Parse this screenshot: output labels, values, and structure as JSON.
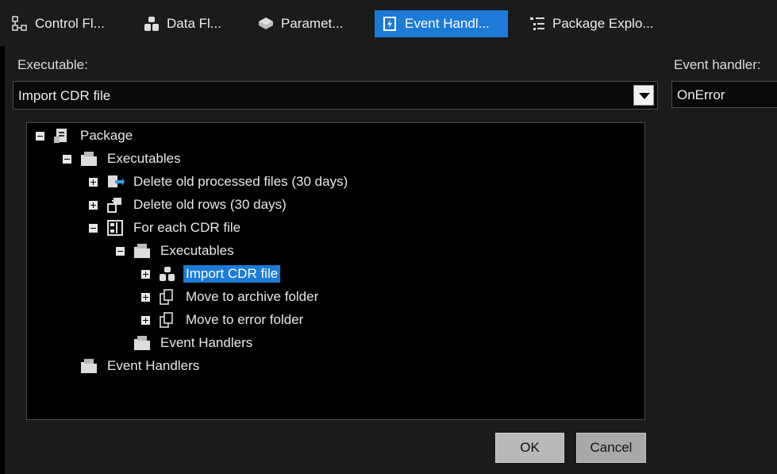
{
  "tabs": [
    {
      "label": "Control Fl...",
      "icon": "control-flow-icon",
      "active": false
    },
    {
      "label": "Data Fl...",
      "icon": "data-flow-icon",
      "active": false
    },
    {
      "label": "Paramet...",
      "icon": "parameters-icon",
      "active": false
    },
    {
      "label": "Event Handl...",
      "icon": "event-handlers-icon",
      "active": true
    },
    {
      "label": "Package Explo...",
      "icon": "package-explorer-icon",
      "active": false
    }
  ],
  "executable": {
    "label": "Executable:",
    "value": "Import CDR file"
  },
  "event_handler": {
    "label": "Event handler:",
    "value": "OnError"
  },
  "tree": [
    {
      "label": "Package",
      "icon": "package-icon",
      "expander": "minus"
    },
    {
      "label": "Executables",
      "icon": "folder-icon",
      "expander": "minus"
    },
    {
      "label": "Delete old processed files (30 days)",
      "icon": "file-system-task-icon",
      "expander": "plus"
    },
    {
      "label": "Delete old rows (30 days)",
      "icon": "sql-task-icon",
      "expander": "plus"
    },
    {
      "label": "For each CDR file",
      "icon": "foreach-loop-icon",
      "expander": "minus"
    },
    {
      "label": "Executables",
      "icon": "folder-icon",
      "expander": "minus"
    },
    {
      "label": "Import CDR file",
      "icon": "data-flow-task-icon",
      "expander": "plus",
      "selected": true
    },
    {
      "label": "Move to archive folder",
      "icon": "file-copy-icon",
      "expander": "plus"
    },
    {
      "label": "Move to error folder",
      "icon": "file-copy-icon",
      "expander": "plus"
    },
    {
      "label": "Event Handlers",
      "icon": "folder-icon",
      "expander": "none"
    },
    {
      "label": "Event Handlers",
      "icon": "folder-icon",
      "expander": "none"
    }
  ],
  "buttons": {
    "ok": "OK",
    "cancel": "Cancel"
  },
  "colors": {
    "accent": "#1c7bd6",
    "background": "#1b1b1b",
    "tree_bg": "#000000"
  }
}
